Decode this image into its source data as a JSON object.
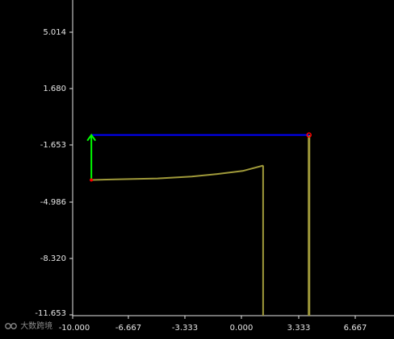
{
  "viewport": {
    "background": "#000000",
    "axis_color": "#e6e6e6",
    "x_ticks": [
      "-10.000",
      "-6.667",
      "-3.333",
      "0.000",
      "3.333",
      "6.667"
    ],
    "y_ticks": [
      "5.014",
      "1.680",
      "-1.653",
      "-4.986",
      "-8.320",
      "-11.653"
    ]
  },
  "scene": {
    "tool_color": "#a09a3a",
    "path_color": "#0000ff",
    "arrow_color": "#00ff00",
    "point_color": "#ff0000",
    "path_start": [
      -8.9,
      -1.0
    ],
    "path_end": [
      3.9,
      -1.0
    ],
    "arrow_base": [
      -8.9,
      -3.65
    ],
    "arrow_tip": [
      -8.9,
      -1.0
    ],
    "profile_points": [
      [
        -8.9,
        -3.65
      ],
      [
        -7.5,
        -3.62
      ],
      [
        -5.0,
        -3.56
      ],
      [
        -3.0,
        -3.45
      ],
      [
        -1.5,
        -3.3
      ],
      [
        0.0,
        -3.12
      ],
      [
        1.2,
        -2.8
      ]
    ],
    "wall_x": 1.2,
    "wall_top_y": -2.8,
    "rod_x": 3.9,
    "rod_top_y": -1.0
  },
  "watermark": {
    "logo_text": "LOO",
    "label": "大数跨境"
  }
}
